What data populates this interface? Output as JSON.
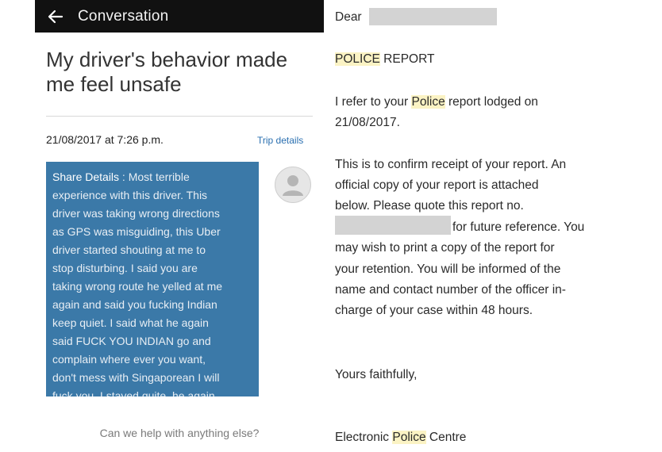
{
  "conversation": {
    "header_title": "Conversation",
    "title_line1": "My driver's behavior made",
    "title_line2": "me feel unsafe",
    "date": "21/08/2017 at 7:26 p.m.",
    "trip_details": "Trip details",
    "message_label": "Share Details",
    "message_lines": [
      " : Most terrible",
      "experience with this driver. This",
      "driver was taking wrong directions",
      "as GPS was misguiding, this Uber",
      "driver started shouting at me to",
      "stop disturbing. I said you are",
      "taking wrong route he yelled at me",
      "again and said you fucking Indian",
      "keep quiet. I said what he again",
      "said FUCK YOU INDIAN go and",
      "complain where ever you want,",
      "don't mess with Singaporean I will",
      "fuck you. I stayed quite, he again"
    ],
    "help_prompt": "Can we help with anything else?"
  },
  "letter": {
    "salutation": "Dear",
    "heading_highlight": "POLICE",
    "heading_rest": " REPORT",
    "para1_l1_a": "I refer to your ",
    "para1_l1_hl": "Police",
    "para1_l1_b": " report lodged on",
    "para1_l2": "21/08/2017.",
    "para2_l1": "This is to confirm receipt of your report. An",
    "para2_l2": "official copy of your report is attached",
    "para2_l3": "below. Please quote this report no.",
    "para2_l4": "for future reference. You",
    "para2_l5": "may wish to print a copy of the report for",
    "para2_l6": "your retention. You will be informed of the",
    "para2_l7": "name and contact number of the officer in-",
    "para2_l8": "charge of your case within 48 hours.",
    "closing": "Yours faithfully,",
    "sign_a": "Electronic ",
    "sign_hl": "Police",
    "sign_b": " Centre"
  }
}
